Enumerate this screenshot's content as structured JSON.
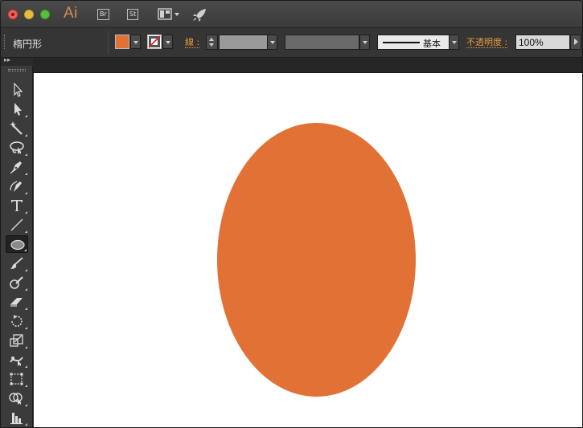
{
  "app": {
    "logo_text": "Ai",
    "bridge_label": "Br",
    "stock_label": "St"
  },
  "control_bar": {
    "object_label": "楕円形",
    "stroke_label": "線 :",
    "stroke_profile_label": "基本",
    "opacity_label": "不透明度 :",
    "opacity_value": "100%"
  },
  "colors": {
    "fill": "#e27136",
    "accent_label": "#e69a3a",
    "canvas": "#ffffff"
  },
  "tools": [
    {
      "name": "selection-tool-icon"
    },
    {
      "name": "direct-selection-tool-icon"
    },
    {
      "name": "magic-wand-tool-icon"
    },
    {
      "name": "lasso-tool-icon"
    },
    {
      "name": "pen-tool-icon"
    },
    {
      "name": "curvature-pen-tool-icon"
    },
    {
      "name": "type-tool-icon",
      "glyph": "T"
    },
    {
      "name": "line-segment-tool-icon"
    },
    {
      "name": "ellipse-tool-icon",
      "active": true
    },
    {
      "name": "paintbrush-tool-icon"
    },
    {
      "name": "blob-brush-tool-icon"
    },
    {
      "name": "eraser-tool-icon"
    },
    {
      "name": "rotate-tool-icon"
    },
    {
      "name": "scale-tool-icon"
    },
    {
      "name": "puppet-warp-tool-icon"
    },
    {
      "name": "free-transform-tool-icon"
    },
    {
      "name": "shape-builder-tool-icon"
    },
    {
      "name": "graph-tool-icon"
    }
  ],
  "canvas": {
    "shape": "ellipse"
  }
}
